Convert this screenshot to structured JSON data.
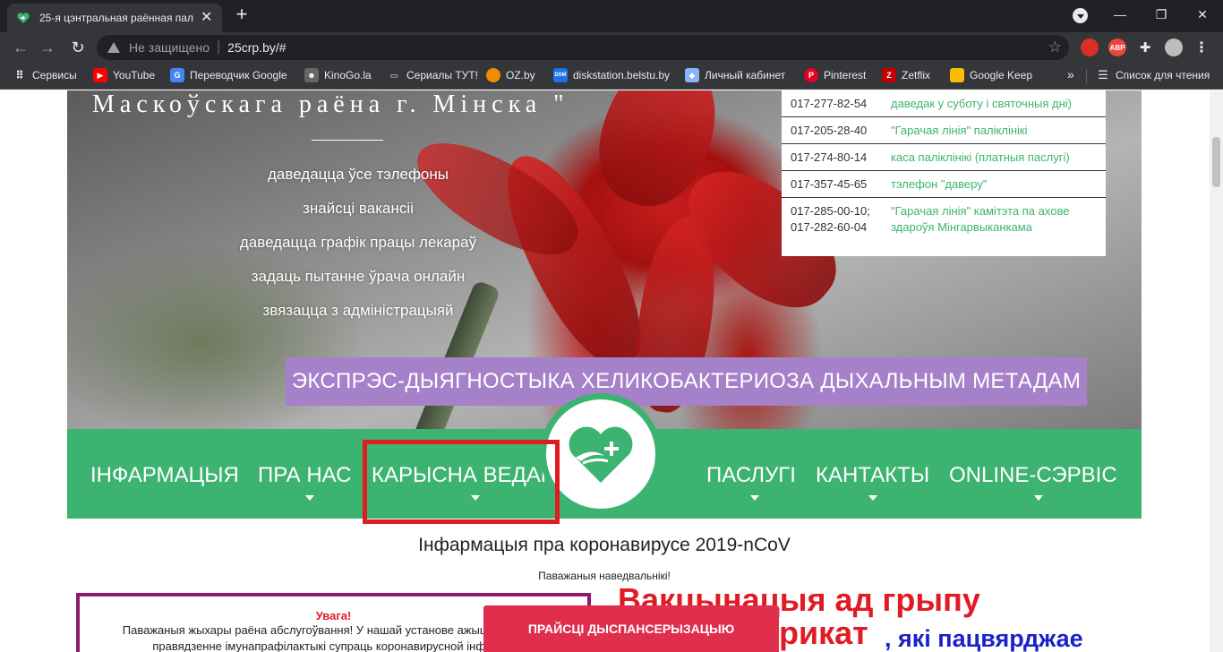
{
  "browser": {
    "tab_title": "25-я цэнтральная раённая палі",
    "tab_close": "✕",
    "new_tab": "+",
    "address": {
      "security_label": "Не защищено",
      "separator": "|",
      "url": "25crp.by/#"
    },
    "window_controls": [
      "—",
      "❐",
      "✕"
    ],
    "extensions": {
      "adblock_label": "ABP"
    },
    "bookmarks": [
      {
        "label": "Сервисы",
        "icon": "apps-grid-icon",
        "color": "#e8eaed"
      },
      {
        "label": "YouTube",
        "icon": "youtube-icon",
        "color": "#ff0000"
      },
      {
        "label": "Переводчик Google",
        "icon": "google-translate-icon",
        "color": "#4285f4"
      },
      {
        "label": "KinoGo.la",
        "icon": "kinogo-icon",
        "color": "#888888"
      },
      {
        "label": "Сериалы ТУТ!",
        "icon": "tv-icon",
        "color": "#e8eaed"
      },
      {
        "label": "OZ.by",
        "icon": "oz-icon",
        "color": "#f28b00"
      },
      {
        "label": "diskstation.belstu.by",
        "icon": "dsm-icon",
        "color": "#1a73e8"
      },
      {
        "label": "Личный кабинет",
        "icon": "cabinet-icon",
        "color": "#8ab4f8"
      },
      {
        "label": "Pinterest",
        "icon": "pinterest-icon",
        "color": "#e60023"
      },
      {
        "label": "Zetflix",
        "icon": "zetflix-icon",
        "color": "#c00000"
      },
      {
        "label": "Google Keep",
        "icon": "google-keep-icon",
        "color": "#fbbc04"
      }
    ],
    "bookmarks_more": "»",
    "reading_list": "Список для чтения"
  },
  "page": {
    "hero": {
      "title": "Маскоўскага раёна г. Мінска \"",
      "links": [
        "даведацца ўсе тэлефоны",
        "знайсці вакансіі",
        "даведацца графік працы лекараў",
        "задаць пытанне ўрача онлайн",
        "звязацца з адміністрацыяй"
      ],
      "phones": [
        {
          "number": "017-277-82-54",
          "desc": "даведак у суботу і святочныя дні)"
        },
        {
          "number": "017-205-28-40",
          "desc": "\"Гарачая лінія\" паліклінікі"
        },
        {
          "number": "017-274-80-14",
          "desc": "каса паліклінікі (платныя паслугі)"
        },
        {
          "number": "017-357-45-65",
          "desc": "тэлефон \"даверу\""
        },
        {
          "number": "017-285-00-10;\n017-282-60-04",
          "desc": "\"Гарачая лінія\" камітэта па ахове здароўя Мінгарвыканкама"
        }
      ],
      "banner": "ЭКСПРЭС-ДЫЯГНОСТЫКА ХЕЛИКОБАКТЕРИОЗА ДЫХАЛЬНЫМ МЕТАДАМ"
    },
    "nav": {
      "items": [
        "ІНФАРМАЦЫЯ",
        "ПРА НАС",
        "КАРЫСНА ВЕДАЦЬ",
        "ПАСЛУГІ",
        "КАНТАКТЫ",
        "ONLINE-СЭРВІС"
      ],
      "accent_color": "#3cb371",
      "highlight_color": "#e01b24"
    },
    "covid": {
      "title": "Інфармацыя пра коронавирусе 2019-nCoV",
      "subtitle": "Паважаныя наведвальнікі!"
    },
    "notice": {
      "title": "Увага!",
      "text": "Паважаныя жыхары раёна абслугоўвання! У нашай установе ажыццяўляецца правядзенне імунапрафілактыкі супраць коронавирусной інфекцыі"
    },
    "vaccination": {
      "line1": "Вакцынацыя ад грыпу",
      "line2": "рикат",
      "line3": ", які пацвярджае"
    },
    "cta": "ПРАЙСЦІ ДЫСПАНСЕРЫЗАЦЫЮ"
  }
}
